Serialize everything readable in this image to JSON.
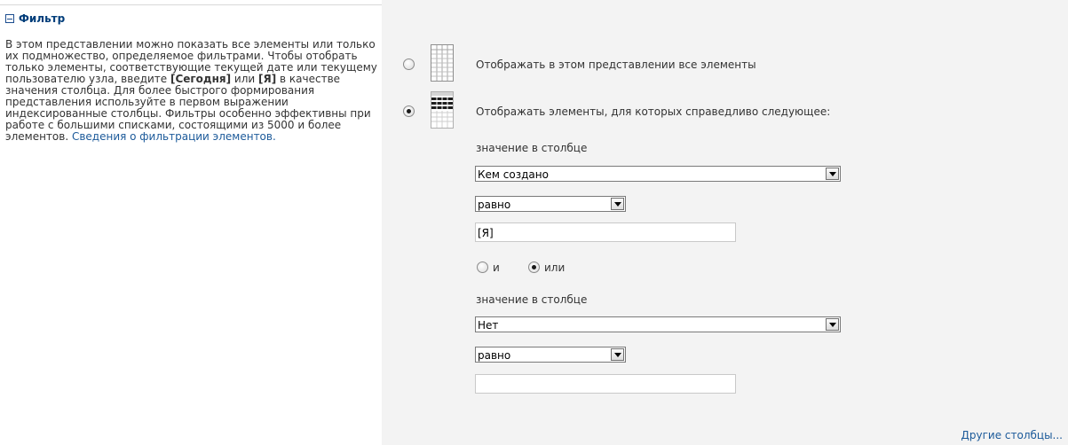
{
  "section": {
    "title": "Фильтр",
    "desc_part1": "В этом представлении можно показать все элементы или только их подмножество, определяемое фильтрами. Чтобы отобрать только элементы, соответствующие текущей дате или текущему пользователю узла, введите ",
    "desc_bold1": "[Сегодня]",
    "desc_mid": " или ",
    "desc_bold2": "[Я]",
    "desc_part2": " в качестве значения столбца. Для более быстрого формирования представления используйте в первом выражении индексированные столбцы. Фильтры особенно эффективны при работе с большими списками, состоящими из 5000 и более элементов. ",
    "desc_link": "Сведения о фильтрации элементов."
  },
  "options": {
    "show_all_label": "Отображать в этом представлении все элементы",
    "show_filtered_label": "Отображать элементы, для которых справедливо следующее:",
    "selected": "show_filtered"
  },
  "filter1": {
    "column_label": "значение в столбце",
    "column_value": "Кем создано",
    "operator_value": "равно",
    "value": "[Я]"
  },
  "logic": {
    "and_label": "и",
    "or_label": "или",
    "selected": "or"
  },
  "filter2": {
    "column_label": "значение в столбце",
    "column_value": "Нет",
    "operator_value": "равно",
    "value": ""
  },
  "more_columns_label": "Другие столбцы..."
}
